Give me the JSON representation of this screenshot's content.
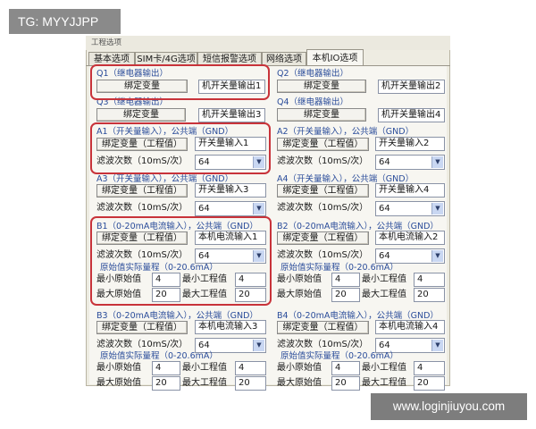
{
  "watermark": {
    "top_left": "TG: MYYJJPP",
    "bottom_right": "www.loginjiuyou.com"
  },
  "window": {
    "title": "工程选项"
  },
  "tabs": [
    {
      "label": "基本选项"
    },
    {
      "label": "SIM卡/4G选项"
    },
    {
      "label": "短信报警选项"
    },
    {
      "label": "网络选项"
    },
    {
      "label": "本机IO选项"
    }
  ],
  "common": {
    "bind_btn": "绑定变量",
    "bind_eng_btn": "绑定变量（工程值）",
    "filter_label": "滤波次数（10mS/次）",
    "filter_value": "64",
    "range_title": "原始值实际量程（0-20.6mA）",
    "min_raw": "最小原始值",
    "min_eng": "最小工程值",
    "max_raw": "最大原始值",
    "max_eng": "最大工程值"
  },
  "outputs": [
    {
      "title": "Q1（继电器输出）",
      "value": "机开关量输出1"
    },
    {
      "title": "Q2（继电器输出）",
      "value": "机开关量输出2"
    },
    {
      "title": "Q3（继电器输出）",
      "value": "机开关量输出3"
    },
    {
      "title": "Q4（继电器输出）",
      "value": "机开关量输出4"
    }
  ],
  "digital_inputs": [
    {
      "title": "A1（开关量输入），公共端（GND）",
      "value": "开关量输入1"
    },
    {
      "title": "A2（开关量输入），公共端（GND）",
      "value": "开关量输入2"
    },
    {
      "title": "A3（开关量输入），公共端（GND）",
      "value": "开关量输入3"
    },
    {
      "title": "A4（开关量输入），公共端（GND）",
      "value": "开关量输入4"
    }
  ],
  "analog_inputs": [
    {
      "title": "B1（0-20mA电流输入），公共端（GND）",
      "value": "本机电流输入1",
      "min_raw": "4",
      "min_eng": "4",
      "max_raw": "20",
      "max_eng": "20"
    },
    {
      "title": "B2（0-20mA电流输入），公共端（GND）",
      "value": "本机电流输入2",
      "min_raw": "4",
      "min_eng": "4",
      "max_raw": "20",
      "max_eng": "20"
    },
    {
      "title": "B3（0-20mA电流输入），公共端（GND）",
      "value": "本机电流输入3",
      "min_raw": "4",
      "min_eng": "4",
      "max_raw": "20",
      "max_eng": "20"
    },
    {
      "title": "B4（0-20mA电流输入），公共端（GND）",
      "value": "本机电流输入4",
      "min_raw": "4",
      "min_eng": "4",
      "max_raw": "20",
      "max_eng": "20"
    }
  ]
}
